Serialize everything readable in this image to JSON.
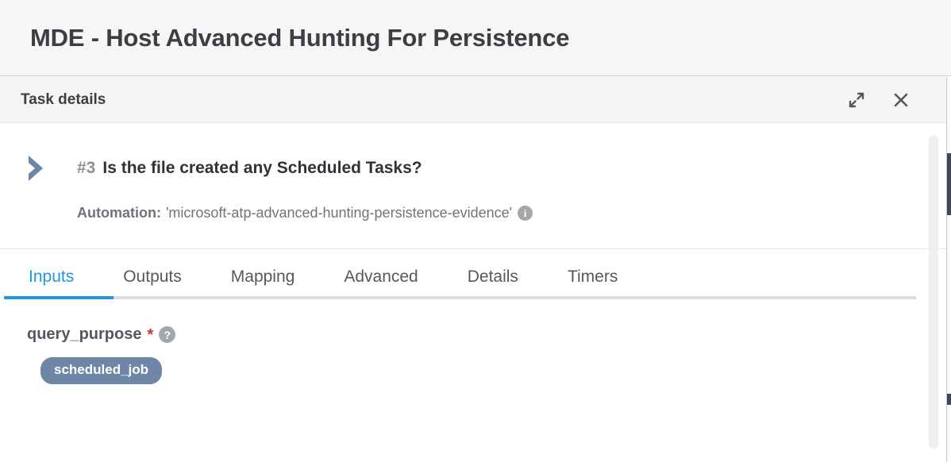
{
  "page": {
    "title": "MDE - Host Advanced Hunting For Persistence"
  },
  "modal": {
    "title": "Task details",
    "actions": {
      "expand_icon": "expand-diagonal-icon",
      "close_icon": "close-icon"
    }
  },
  "task": {
    "marker_icon": "chevron-right-icon",
    "number": "#3",
    "question": "Is the file created any Scheduled Tasks?",
    "automation_label": "Automation:",
    "automation_value": "'microsoft-atp-advanced-hunting-persistence-evidence'",
    "automation_info_icon": "info-icon",
    "automation_info_glyph": "i"
  },
  "tabs": {
    "active": "Inputs",
    "items": [
      {
        "label": "Inputs"
      },
      {
        "label": "Outputs"
      },
      {
        "label": "Mapping"
      },
      {
        "label": "Advanced"
      },
      {
        "label": "Details"
      },
      {
        "label": "Timers"
      }
    ]
  },
  "form": {
    "fields": [
      {
        "label": "query_purpose",
        "required_marker": "*",
        "help_icon": "help-circle-icon",
        "help_glyph": "?",
        "value_chip": "scheduled_job"
      }
    ]
  },
  "colors": {
    "accent_blue": "#2196e3",
    "chip_slate": "#6f87a6",
    "chevron_slate": "#6c85a9",
    "required_red": "#c0392b",
    "muted_gray": "#8a9099",
    "header_bg": "#f5f5f5"
  }
}
